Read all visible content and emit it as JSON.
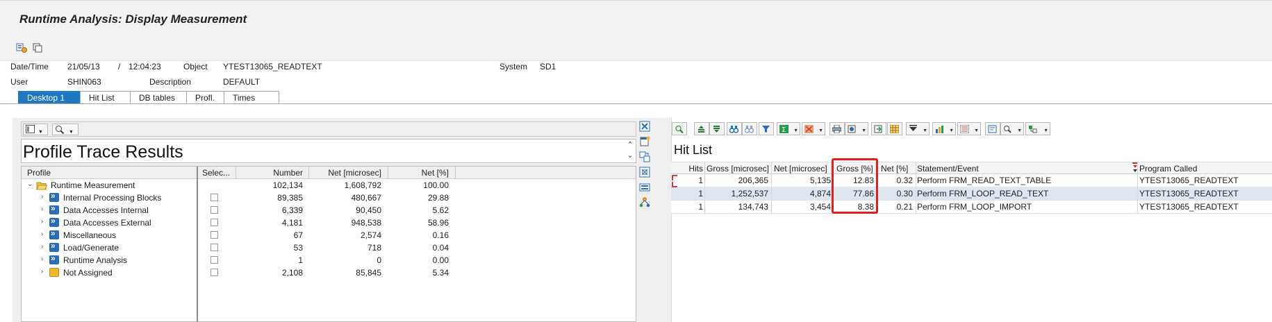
{
  "window": {
    "title": "Runtime Analysis: Display Measurement"
  },
  "toolbar": {
    "icons": [
      "variant-tree-icon",
      "copy-icon"
    ]
  },
  "header": {
    "datetime_label": "Date/Time",
    "date": "21/05/13",
    "slash": "/",
    "time": "12:04:23",
    "object_label": "Object",
    "object_value": "YTEST13065_READTEXT",
    "system_label": "System",
    "system_value": "SD1",
    "user_label": "User",
    "user_value": "SHIN063",
    "description_label": "Description",
    "description_value": "DEFAULT"
  },
  "tabs": [
    {
      "label": "Desktop 1",
      "active": true
    },
    {
      "label": "Hit List"
    },
    {
      "label": "DB tables"
    },
    {
      "label": "Profl."
    },
    {
      "label": "Times"
    }
  ],
  "profile": {
    "title": "Profile Trace Results",
    "columns": [
      "Profile",
      "Selec...",
      "Number",
      "Net [microsec]",
      "Net [%]"
    ],
    "rows": [
      {
        "name": "Runtime Measurement",
        "icon": "folder-open-icon",
        "number": "102,134",
        "net": "1,608,792",
        "pct": "100.00",
        "level": 0,
        "expanded": true,
        "checkbox": false
      },
      {
        "name": "Internal Processing Blocks",
        "icon": "block-icon",
        "number": "89,385",
        "net": "480,667",
        "pct": "29.88",
        "level": 1,
        "checkbox": true
      },
      {
        "name": "Data Accesses Internal",
        "icon": "block-icon",
        "number": "6,339",
        "net": "90,450",
        "pct": "5.62",
        "level": 1,
        "checkbox": true
      },
      {
        "name": "Data Accesses External",
        "icon": "block-icon",
        "number": "4,181",
        "net": "948,538",
        "pct": "58.96",
        "level": 1,
        "checkbox": true
      },
      {
        "name": "Miscellaneous",
        "icon": "block-icon",
        "number": "67",
        "net": "2,574",
        "pct": "0.16",
        "level": 1,
        "checkbox": true
      },
      {
        "name": "Load/Generate",
        "icon": "block-icon",
        "number": "53",
        "net": "718",
        "pct": "0.04",
        "level": 1,
        "checkbox": true
      },
      {
        "name": "Runtime Analysis",
        "icon": "block-icon",
        "number": "1",
        "net": "0",
        "pct": "0.00",
        "level": 1,
        "checkbox": true
      },
      {
        "name": "Not Assigned",
        "icon": "folder-icon",
        "number": "2,108",
        "net": "85,845",
        "pct": "5.34",
        "level": 1,
        "checkbox": true
      }
    ]
  },
  "hitlist": {
    "title": "Hit List",
    "columns": [
      "Hits",
      "Gross [microsec]",
      "Net [microsec]",
      "Gross [%]",
      "Net [%]",
      "Statement/Event",
      "Program Called"
    ],
    "rows": [
      {
        "hits": "1",
        "gross": "206,365",
        "net": "5,135",
        "gross_pct": "12.83",
        "net_pct": "0.32",
        "statement": "Perform FRM_READ_TEXT_TABLE",
        "program": "YTEST13065_READTEXT",
        "selected": false
      },
      {
        "hits": "1",
        "gross": "1,252,537",
        "net": "4,874",
        "gross_pct": "77.86",
        "net_pct": "0.30",
        "statement": "Perform FRM_LOOP_READ_TEXT",
        "program": "YTEST13065_READTEXT",
        "selected": true
      },
      {
        "hits": "1",
        "gross": "134,743",
        "net": "3,454",
        "gross_pct": "8.38",
        "net_pct": "0.21",
        "statement": "Perform FRM_LOOP_IMPORT",
        "program": "YTEST13065_READTEXT",
        "selected": false
      }
    ],
    "highlight_color": "#e02020"
  }
}
